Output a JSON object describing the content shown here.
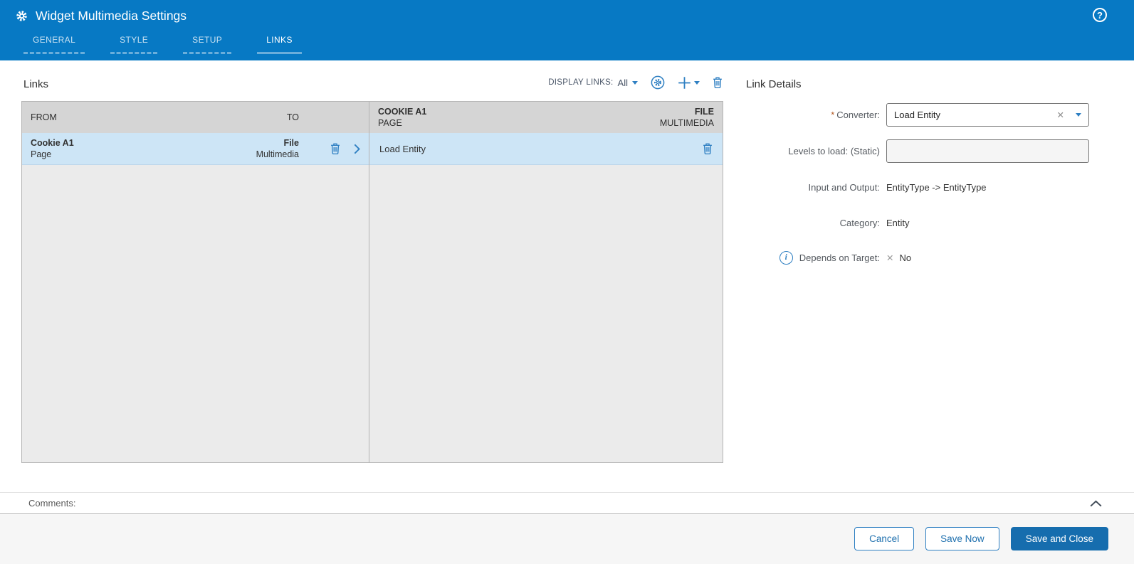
{
  "colors": {
    "header_blue": "#0779c4",
    "icon_blue": "#2e7fc2",
    "selected_row_blue": "#cde5f6",
    "primary_button_blue": "#166dae"
  },
  "window": {
    "title": "Widget Multimedia Settings",
    "tabs": [
      "GENERAL",
      "STYLE",
      "SETUP",
      "LINKS"
    ],
    "active_tab": "LINKS"
  },
  "links": {
    "title": "Links",
    "toolbar": {
      "display_links_label": "DISPLAY LINKS:",
      "display_links_value": "All"
    },
    "from_to_table": {
      "col_from": "FROM",
      "col_to": "TO",
      "row": {
        "from_name": "Cookie A1",
        "from_type": "Page",
        "to_name": "File",
        "to_type": "Multimedia"
      }
    },
    "converters_table": {
      "header_from_name": "COOKIE A1",
      "header_from_type": "PAGE",
      "header_to_name": "FILE",
      "header_to_type": "MULTIMEDIA",
      "row": {
        "converter": "Load Entity"
      }
    }
  },
  "details": {
    "title": "Link Details",
    "required_marker": "*",
    "converter_label": "Converter:",
    "converter_value": "Load Entity",
    "levels_label": "Levels to load: (Static)",
    "levels_value": "",
    "io_label": "Input and Output:",
    "io_value": "EntityType -> EntityType",
    "category_label": "Category:",
    "category_value": "Entity",
    "depends_label": "Depends on Target:",
    "depends_value": "No"
  },
  "comments": {
    "label": "Comments:"
  },
  "footer": {
    "cancel": "Cancel",
    "save_now": "Save Now",
    "save_and_close": "Save and Close"
  },
  "icons": {
    "help": "?",
    "info": "i",
    "clear": "✕",
    "no_cross": "✕"
  }
}
